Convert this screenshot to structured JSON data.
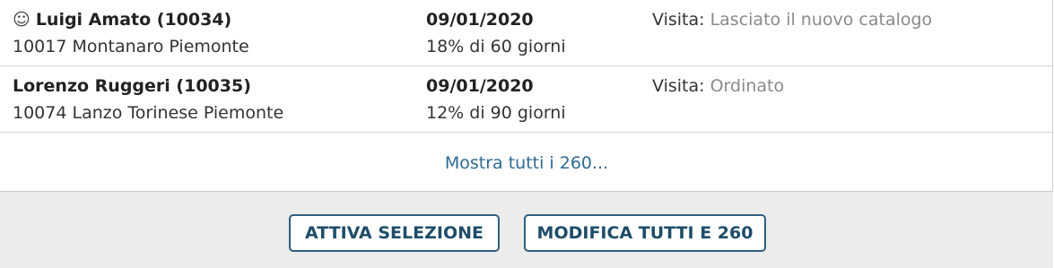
{
  "rows": [
    {
      "icon": "smiley-icon",
      "icon_glyph": "☺",
      "name": "Luigi Amato (10034)",
      "address": "10017 Montanaro Piemonte",
      "date": "09/01/2020",
      "terms": "18% di 60 giorni",
      "visit_label": "Visita:",
      "visit_value": "Lasciato il nuovo catalogo"
    },
    {
      "name": "Lorenzo Ruggeri (10035)",
      "address": "10074 Lanzo Torinese Piemonte",
      "date": "09/01/2020",
      "terms": "12% di 90 giorni",
      "visit_label": "Visita:",
      "visit_value": "Ordinato"
    }
  ],
  "show_all_link": "Mostra tutti i 260...",
  "footer": {
    "activate_selection_label": "ATTIVA SELEZIONE",
    "edit_all_label": "MODIFICA TUTTI E 260"
  },
  "colors": {
    "link": "#2d6a93",
    "button_border": "#2f5f7f",
    "footer_bg": "#ececec",
    "muted_value": "#8a8a8a"
  }
}
